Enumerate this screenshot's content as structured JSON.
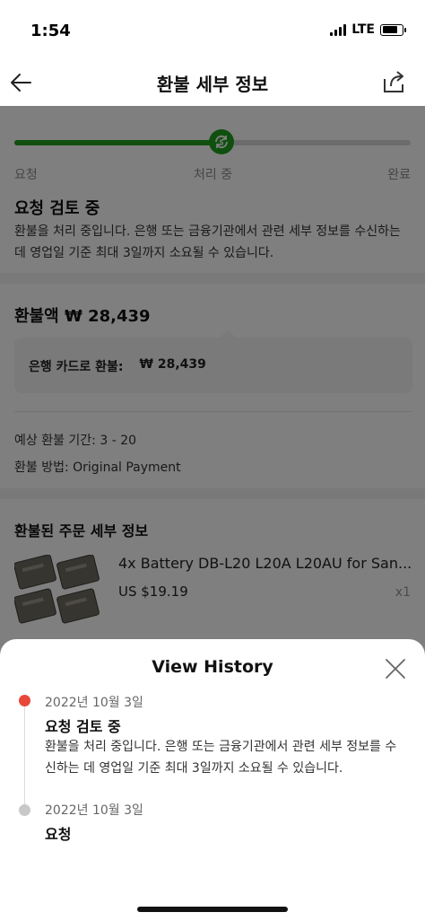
{
  "status_bar": {
    "time": "1:54",
    "network": "LTE"
  },
  "nav": {
    "title": "환불 세부 정보",
    "back_icon": "arrow-left-icon",
    "share_icon": "share-icon"
  },
  "progress": {
    "fraction": 0.52,
    "steps": [
      "요청",
      "처리 중",
      "완료"
    ],
    "accent_color": "#1ea01e"
  },
  "status": {
    "heading": "요청 검토 중",
    "description": "환불을 처리 중입니다. 은행 또는 금융기관에서 관련 세부 정보를 수신하는 데 영업일 기준 최대 3일까지 소요될 수 있습니다."
  },
  "refund": {
    "label": "환불액",
    "amount": "₩ 28,439",
    "method_label": "은행 카드로 환불:",
    "method_amount": "₩ 28,439",
    "period": "예상 환불 기간: 3 - 20",
    "payment_method": "환불 방법: Original Payment"
  },
  "order": {
    "section_title": "환불된 주문 세부 정보",
    "product_name": "4x Battery DB-L20 L20A L20AU for San...",
    "price": "US $19.19",
    "qty": "x1"
  },
  "history": {
    "title": "View History",
    "entries": [
      {
        "date": "2022년 10월 3일",
        "title": "요청 검토 중",
        "description": "환불을 처리 중입니다. 은행 또는 금융기관에서 관련 세부 정보를 수신하는 데 영업일 기준 최대 3일까지 소요될 수 있습니다.",
        "dot_color": "#e8473a"
      },
      {
        "date": "2022년 10월 3일",
        "title": "요청",
        "dot_color": "#c8c8c8"
      }
    ]
  }
}
